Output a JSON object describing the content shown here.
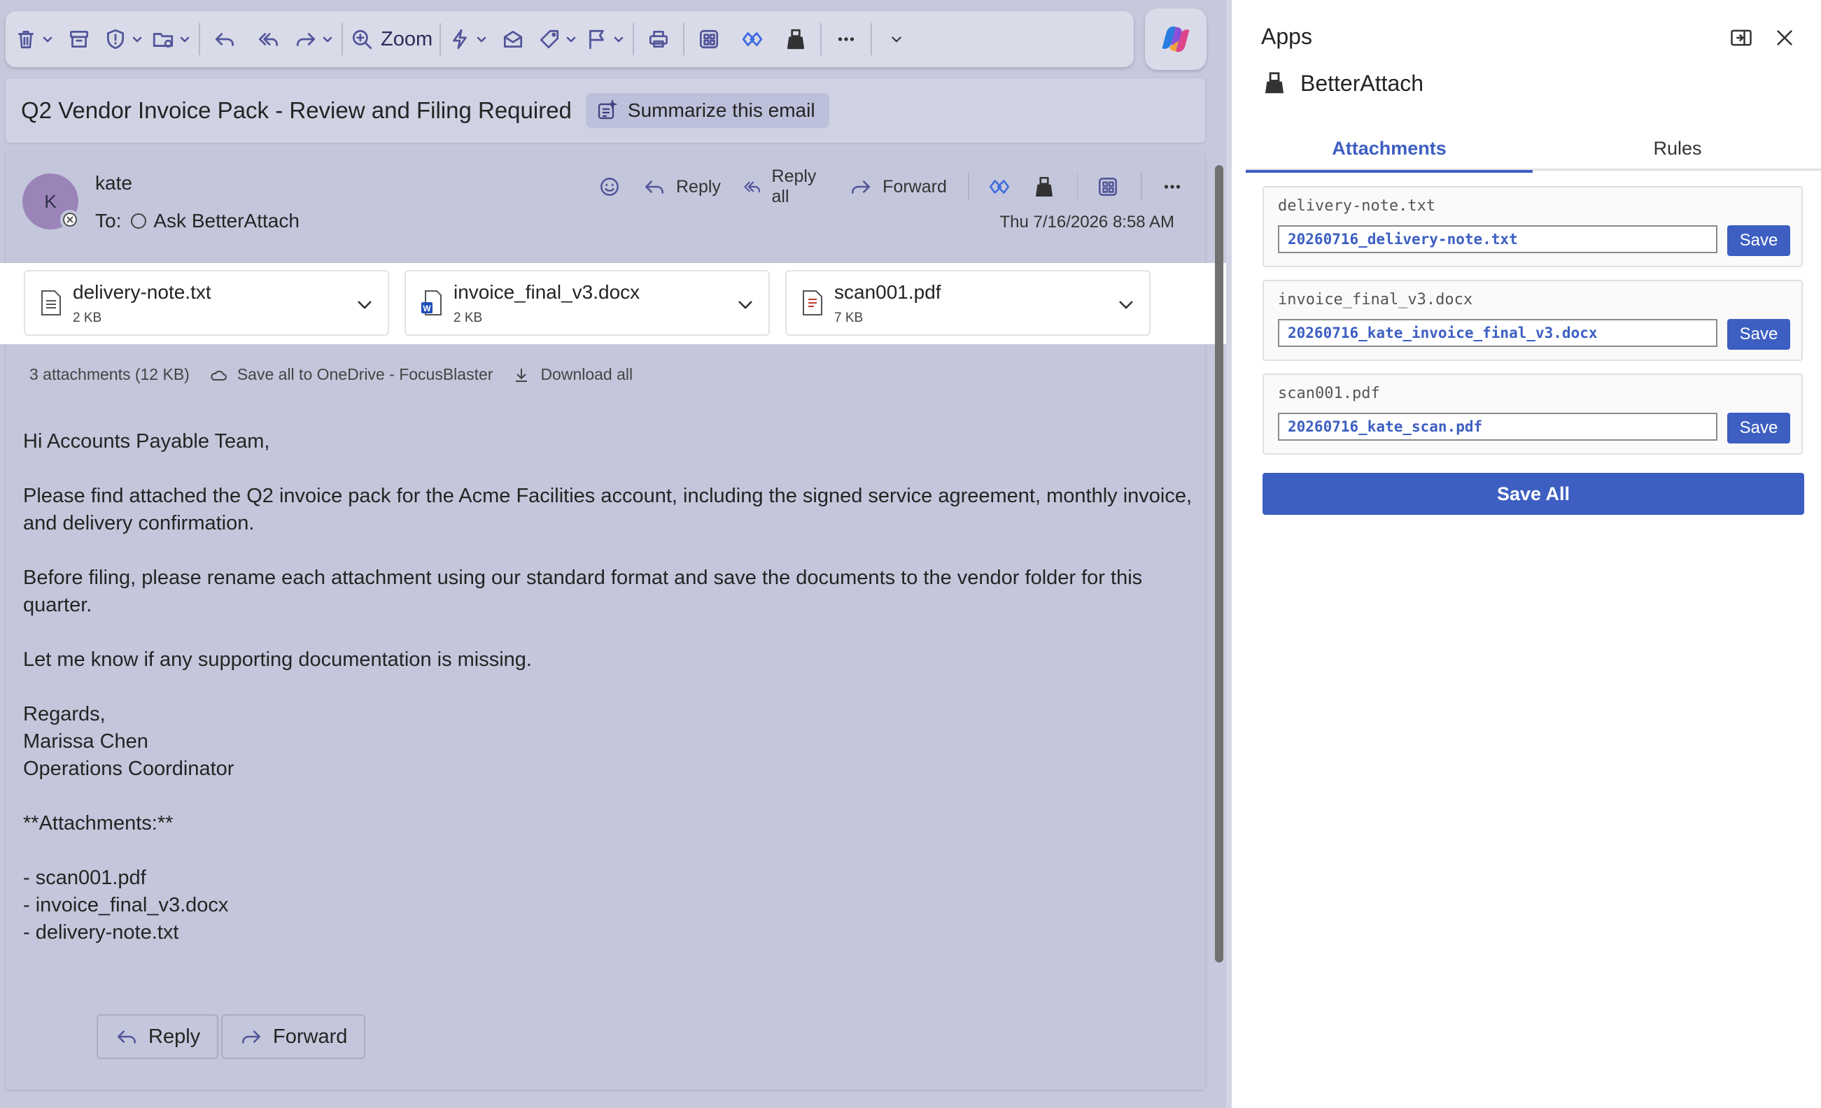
{
  "toolbar": {
    "zoom_label": "Zoom",
    "icons": [
      "delete-icon",
      "archive-icon",
      "report-icon",
      "move-icon",
      "reply-icon",
      "reply-all-icon",
      "forward-icon",
      "zoom-icon",
      "quick-steps-icon",
      "read-unread-icon",
      "tag-icon",
      "flag-icon",
      "print-icon",
      "apps-icon",
      "betterattach-icon",
      "betterattach-clip-icon",
      "more-icon",
      "expand-icon",
      "copilot-icon"
    ]
  },
  "message": {
    "subject": "Q2 Vendor Invoice Pack - Review and Filing Required",
    "summarize_label": "Summarize this email",
    "avatar_initial": "K",
    "sender": "kate",
    "to_prefix": "To:",
    "to_recipient": "Ask BetterAttach",
    "date": "Thu 7/16/2026 8:58 AM",
    "actions": {
      "reply": "Reply",
      "reply_all": "Reply all",
      "forward": "Forward"
    }
  },
  "attachments": [
    {
      "name": "delivery-note.txt",
      "size": "2 KB",
      "type": "txt"
    },
    {
      "name": "invoice_final_v3.docx",
      "size": "2 KB",
      "type": "docx"
    },
    {
      "name": "scan001.pdf",
      "size": "7 KB",
      "type": "pdf"
    }
  ],
  "attachment_summary": {
    "count": "3 attachments (12 KB)",
    "save_all_onedrive": "Save all to OneDrive - FocusBlaster",
    "download_all": "Download all"
  },
  "body": {
    "greeting": "Hi Accounts Payable Team,",
    "para1": "Please find attached the Q2 invoice pack for the Acme Facilities account, including the signed service agreement, monthly invoice, and delivery confirmation.",
    "para2": "Before filing, please rename each attachment using our standard format and save the documents to the vendor folder for this quarter.",
    "para3": "Let me know if any supporting documentation is missing.",
    "signoff": "Regards,",
    "sig_name": "Marissa Chen",
    "sig_title": "Operations Coordinator",
    "att_heading": "**Attachments:**",
    "att_list": [
      "- scan001.pdf",
      "- invoice_final_v3.docx",
      "- delivery-note.txt"
    ]
  },
  "footer": {
    "reply": "Reply",
    "forward": "Forward"
  },
  "apps_pane": {
    "title": "Apps",
    "addin_name": "BetterAttach",
    "tabs": [
      "Attachments",
      "Rules"
    ],
    "active_tab": "Attachments",
    "items": [
      {
        "original": "delivery-note.txt",
        "new_name": "20260716_delivery-note.txt",
        "save": "Save"
      },
      {
        "original": "invoice_final_v3.docx",
        "new_name": "20260716_kate_invoice_final_v3.docx",
        "save": "Save"
      },
      {
        "original": "scan001.pdf",
        "new_name": "20260716_kate_scan.pdf",
        "save": "Save"
      }
    ],
    "save_all": "Save All"
  },
  "colors": {
    "accent": "#3d5fc2",
    "email_bg": "#c6c9dc",
    "icon": "#52569a"
  }
}
